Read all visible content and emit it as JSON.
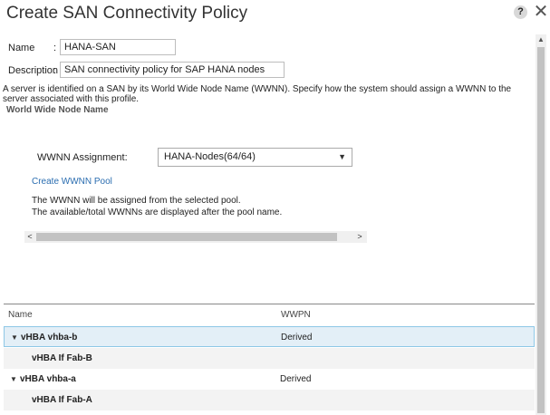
{
  "dialog": {
    "title": "Create SAN Connectivity Policy",
    "help_label": "?",
    "close_label": "✕"
  },
  "form": {
    "name_label": "Name",
    "name_value": "HANA-SAN",
    "description_label": "Description",
    "description_value": "SAN connectivity policy for SAP HANA nodes",
    "colon": ":"
  },
  "intro_text": "A server is identified on a SAN by its World Wide Node Name (WWNN). Specify how the system should assign a WWNN to the server associated with this profile.",
  "wwnn_section": {
    "heading": "World Wide Node Name",
    "assignment_label": "WWNN Assignment:",
    "assignment_value": "HANA-Nodes(64/64)",
    "create_pool_link": "Create WWNN Pool",
    "info_line1": "The WWNN will be assigned from the selected pool.",
    "info_line2": "The available/total WWNNs are displayed after the pool name."
  },
  "table": {
    "columns": [
      "Name",
      "WWPN"
    ],
    "rows": [
      {
        "name": "vHBA vhba-b",
        "wwpn": "Derived",
        "expandable": true
      },
      {
        "name": "vHBA If Fab-B",
        "wwpn": "",
        "expandable": false
      },
      {
        "name": "vHBA vhba-a",
        "wwpn": "Derived",
        "expandable": true
      },
      {
        "name": "vHBA If Fab-A",
        "wwpn": "",
        "expandable": false
      }
    ]
  },
  "colors": {
    "selection_bg": "#e3eff7",
    "selection_border": "#8ec8e6",
    "link": "#2a6db0"
  },
  "icons": {
    "help": "help-icon",
    "close": "close-icon",
    "dropdown": "chevron-down-icon",
    "expand": "caret-down-icon"
  }
}
